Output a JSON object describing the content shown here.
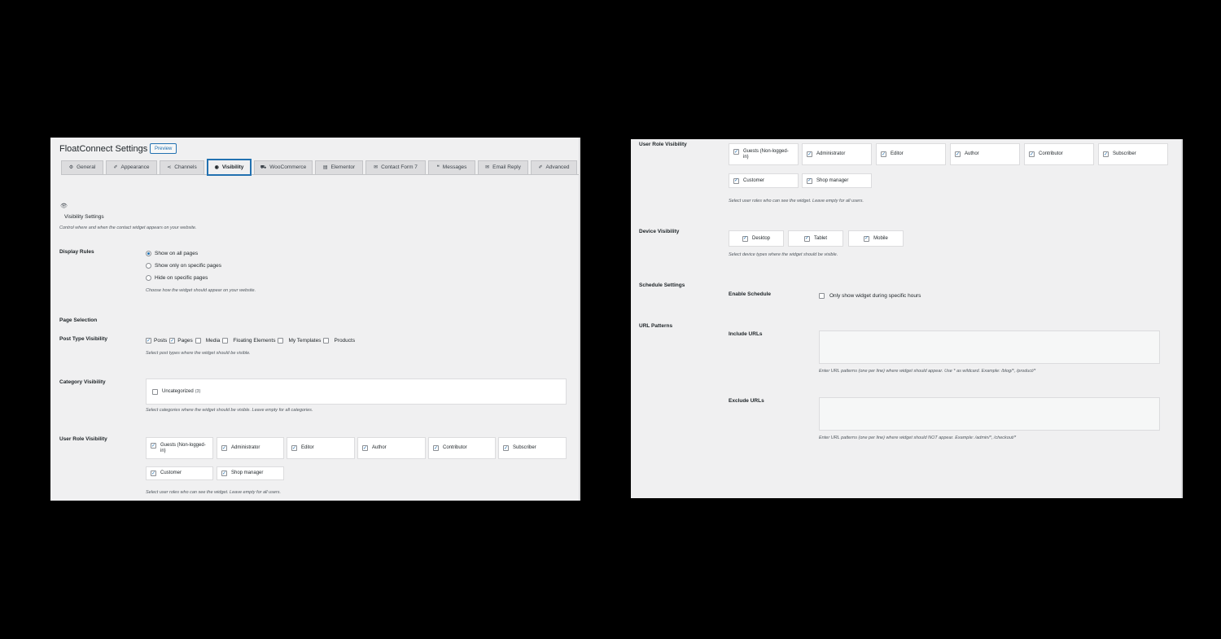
{
  "header": {
    "title": "FloatConnect Settings",
    "preview": "Preview"
  },
  "tabs": [
    {
      "icon": "⚙",
      "label": "General"
    },
    {
      "icon": "✐",
      "label": "Appearance"
    },
    {
      "icon": "⋖",
      "label": "Channels"
    },
    {
      "icon": "◉",
      "label": "Visibility"
    },
    {
      "icon": "⛟",
      "label": "WooCommerce"
    },
    {
      "icon": "▤",
      "label": "Elementor"
    },
    {
      "icon": "✉",
      "label": "Contact Form 7"
    },
    {
      "icon": "❝",
      "label": "Messages"
    },
    {
      "icon": "✉",
      "label": "Email Reply"
    },
    {
      "icon": "✐",
      "label": "Advanced"
    }
  ],
  "section": {
    "heading": "Visibility Settings",
    "desc": "Control where and when the contact widget appears on your website."
  },
  "display_rules": {
    "label": "Display Rules",
    "options": [
      "Show on all pages",
      "Show only on specific pages",
      "Hide on specific pages"
    ],
    "selected": "Show on all pages",
    "desc": "Choose how the widget should appear on your website."
  },
  "page_selection": {
    "label": "Page Selection"
  },
  "post_type": {
    "label": "Post Type Visibility",
    "items": [
      {
        "label": "Posts",
        "checked": true
      },
      {
        "label": "Pages",
        "checked": true
      },
      {
        "label": "Media",
        "checked": false
      },
      {
        "label": "Floating Elements",
        "checked": false
      },
      {
        "label": "My Templates",
        "checked": false
      },
      {
        "label": "Products",
        "checked": false
      }
    ],
    "desc": "Select post types where the widget should be visible."
  },
  "category": {
    "label": "Category Visibility",
    "item": "Uncategorized",
    "count": "(3)",
    "desc": "Select categories where the widget should be visible. Leave empty for all categories."
  },
  "user_role": {
    "label": "User Role Visibility",
    "roles": [
      "Guests (Non-logged-in)",
      "Administrator",
      "Editor",
      "Author",
      "Contributor",
      "Subscriber",
      "Customer",
      "Shop manager"
    ],
    "desc": "Select user roles who can see the widget. Leave empty for all users."
  },
  "device": {
    "label": "Device Visibility",
    "items": [
      "Desktop",
      "Tablet",
      "Mobile"
    ],
    "desc": "Select device types where the widget should be visible."
  },
  "schedule": {
    "label": "Schedule Settings",
    "enable_label": "Enable Schedule",
    "checkbox": "Only show widget during specific hours"
  },
  "url_patterns": {
    "label": "URL Patterns",
    "include_label": "Include URLs",
    "include_desc": "Enter URL patterns (one per line) where widget should appear. Use * as wildcard. Example: /blog/*, /product/*",
    "exclude_label": "Exclude URLs",
    "exclude_desc": "Enter URL patterns (one per line) where widget should NOT appear. Example: /admin/*, /checkout/*"
  },
  "colors": {
    "accent": "#2271b1",
    "background": "#f0f0f1",
    "frame": "#000000"
  }
}
